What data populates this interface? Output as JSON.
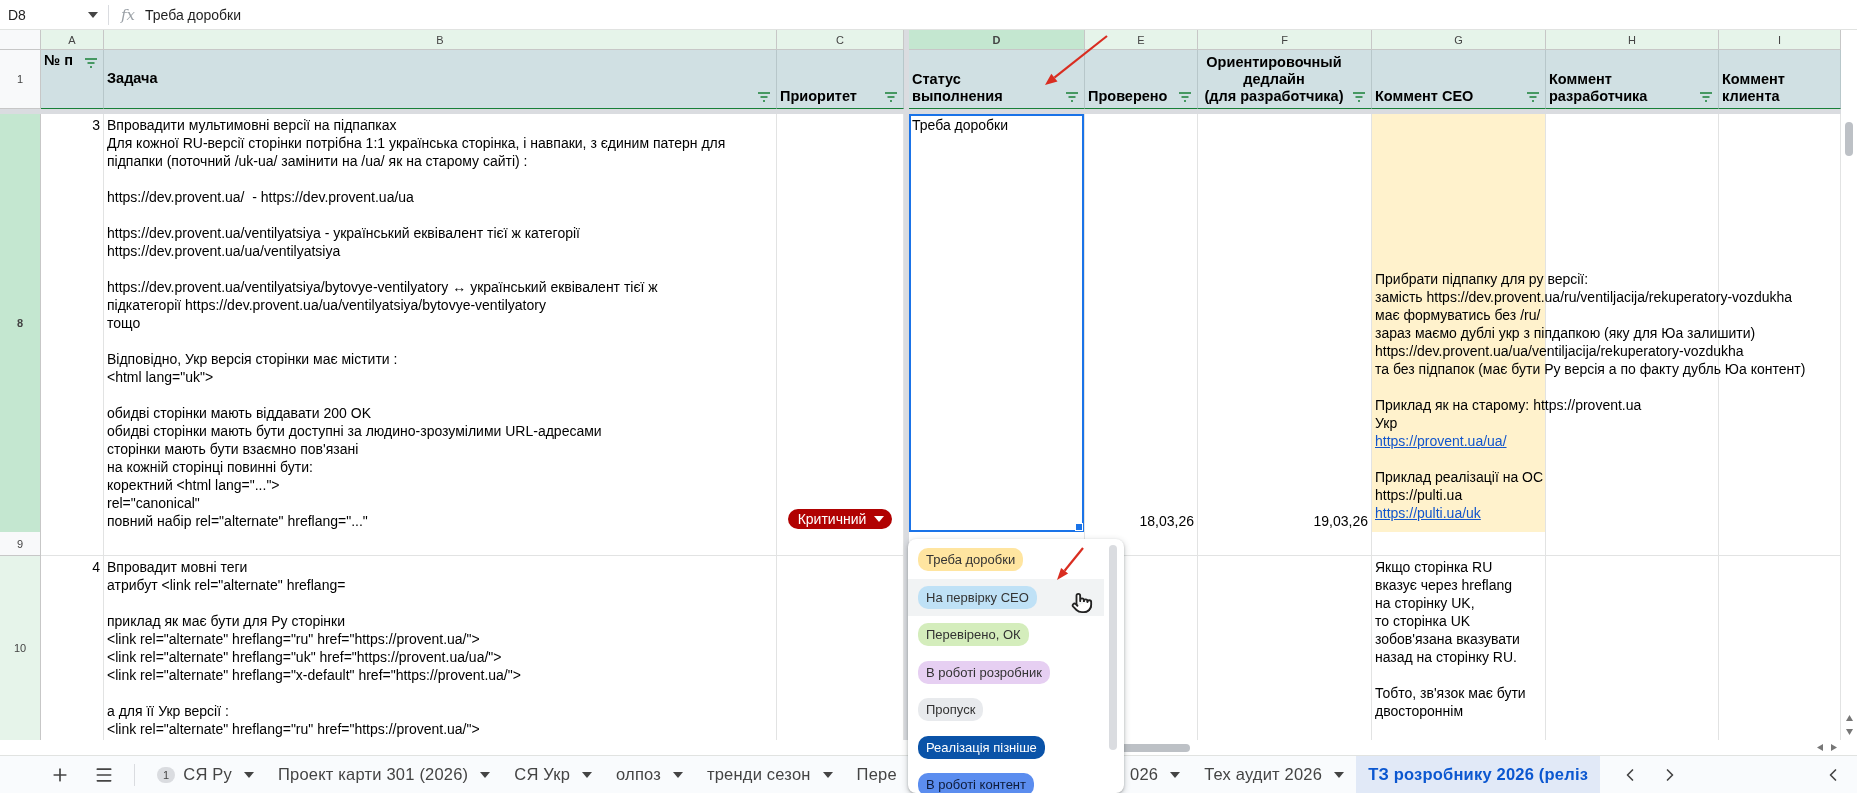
{
  "formula_bar": {
    "cell_ref": "D8",
    "icon_text": "fx",
    "formula": "Треба доробки"
  },
  "columns": [
    {
      "letter": "A",
      "selected": false
    },
    {
      "letter": "B",
      "selected": false
    },
    {
      "letter": "C",
      "selected": false
    },
    {
      "letter": "D",
      "selected": true
    },
    {
      "letter": "E",
      "selected": false
    },
    {
      "letter": "F",
      "selected": false
    },
    {
      "letter": "G",
      "selected": false
    },
    {
      "letter": "H",
      "selected": false
    },
    {
      "letter": "I",
      "selected": false
    }
  ],
  "header_row": {
    "number": "1",
    "cells": [
      {
        "text": "№ п",
        "filter": true
      },
      {
        "text": "Задача",
        "filter": true
      },
      {
        "text": "Приоритет",
        "filter": true
      },
      {
        "text": "Статус\nвыполнения",
        "filter": true
      },
      {
        "text": "Проверено",
        "filter": true
      },
      {
        "text": "Ориентировочный\nдедлайн\n(для разработчика)",
        "filter": true
      },
      {
        "text": "Коммент СЕО",
        "filter": true
      },
      {
        "text": "Коммент\nразработчика",
        "filter": true
      },
      {
        "text": "Коммент\nклиента",
        "filter": false
      }
    ]
  },
  "rows": [
    {
      "number": "8",
      "selected": true,
      "highlighted": false,
      "cells": [
        {
          "kind": "number",
          "text": "3",
          "selected": false
        },
        {
          "kind": "text",
          "selected": false,
          "text": "Впровадити мультимовні версії на підпапках\nДля кожної RU-версії сторінки потрібна 1:1 українська сторінка, і навпаки, з єдиним патерн для\nпідпапки (поточний /uk-ua/ замінити на /ua/ як на старому сайті) :\n\nhttps://dev.provent.ua/  - https://dev.provent.ua/ua\n\nhttps://dev.provent.ua/ventilyatsiya - український еквівалент тієї ж категорії\nhttps://dev.provent.ua/ua/ventilyatsiya\n\nhttps://dev.provent.ua/ventilyatsiya/bytovye-ventilyatory ↔ український еквівалент тієї ж\nпідкатегорії https://dev.provent.ua/ua/ventilyatsiya/bytovye-ventilyatory\nтощо\n\nВідповідно, Укр версія сторінки має містити :\n<html lang=\"uk\">\n\nобидві сторінки мають віддавати 200 OK\nобидві сторінки мають бути доступні за людино-зрозумілими URL-адресами\nсторінки мають бути взаємно пов'язані\nна кожній сторінці повинні бути:\nкоректний <html lang=\"...\">\nrel=\"canonical\"\nповний набір rel=\"alternate\" hreflang=\"...\""
        },
        {
          "kind": "chip",
          "text": "Критичний",
          "selected": false
        },
        {
          "kind": "text",
          "text": "Треба доробки",
          "selected": true
        },
        {
          "kind": "date",
          "text": "18,03,26",
          "selected": false
        },
        {
          "kind": "date",
          "text": "19,03,26",
          "selected": false
        },
        {
          "kind": "note",
          "selected": false,
          "segments": [
            {
              "text": "Прибрати підпапку для ру версії:\nзамість https://dev.provent.ua/ru/ventiljacija/rekuperatory-vozdukha\nмає формуватись без /ru/\nзараз маємо дублі укр з піпдапкою (яку для Юа залишити)\nhttps://dev.provent.ua/ua/ventiljacija/rekuperatory-vozdukha\nта без підпапок (має бути Ру версія а по факту дубль Юа контент)\n\nПриклад як на старому: https://provent.ua\nУкр\n",
              "link": false
            },
            {
              "text": "https://provent.ua/ua/",
              "link": true
            },
            {
              "text": "\n\nПриклад реалізації на ОС\nhttps://pulti.ua\n",
              "link": false
            },
            {
              "text": "https://pulti.ua/uk",
              "link": true
            }
          ]
        }
      ]
    },
    {
      "number": "9",
      "selected": false,
      "highlighted": false,
      "cells": [
        {
          "kind": "empty",
          "selected": false
        },
        {
          "kind": "empty",
          "selected": false
        },
        {
          "kind": "empty",
          "selected": false
        },
        {
          "kind": "covered"
        },
        {
          "kind": "empty",
          "selected": false
        },
        {
          "kind": "empty",
          "selected": false
        },
        {
          "kind": "empty",
          "selected": false
        },
        {
          "kind": "empty",
          "selected": false
        },
        {
          "kind": "empty",
          "selected": false
        }
      ]
    },
    {
      "number": "10",
      "selected": false,
      "highlighted": true,
      "cells": [
        {
          "kind": "number",
          "text": "4",
          "selected": false
        },
        {
          "kind": "text",
          "selected": false,
          "text": "Впровадит мовні теги\nатрибут <link rel=\"alternate\" hreflang=\n\nприклад як має бути для Ру сторінки\n<link rel=\"alternate\" hreflang=\"ru\" href=\"https://provent.ua/\">\n<link rel=\"alternate\" hreflang=\"uk\" href=\"https://provent.ua/ua/\">\n<link rel=\"alternate\" hreflang=\"x-default\" href=\"https://provent.ua/\">\n\nа для її Укр версії :\n<link rel=\"alternate\" hreflang=\"ru\" href=\"https://provent.ua/\">"
        },
        {
          "kind": "empty",
          "selected": false
        },
        {
          "kind": "covered"
        },
        {
          "kind": "empty",
          "selected": false
        },
        {
          "kind": "empty",
          "selected": false
        },
        {
          "kind": "text",
          "selected": false,
          "text": "Якщо сторінка RU\nвказує через hreflang\nна сторінку UK,\nто сторінка UK\nзобов'язана вказувати\nназад на сторінку RU.\n\nТобто, зв'язок має бути\nдвостороннім"
        },
        {
          "kind": "empty",
          "selected": false
        },
        {
          "kind": "empty",
          "selected": false
        }
      ]
    }
  ],
  "status_menu": {
    "options": [
      {
        "label": "Треба доробки",
        "color": "#ffe5a0",
        "hovered": false
      },
      {
        "label": "На первірку СЕО",
        "color": "#bfe1f6",
        "hovered": true
      },
      {
        "label": "Перевірено, ОК",
        "color": "#d4edbc",
        "hovered": false
      },
      {
        "label": "В роботі розробник",
        "color": "#e6cff2",
        "hovered": false
      },
      {
        "label": "Пропуск",
        "color": "#e8eaed",
        "hovered": false
      },
      {
        "label": "Реалізація пізніше",
        "color": "#0a53a8",
        "hovered": false
      },
      {
        "label": "В роботі контент",
        "color": "#5b8def",
        "hovered": false
      }
    ]
  },
  "sheet_tabs": [
    {
      "label": "СЯ Ру",
      "badge": "1",
      "kind": "sheet",
      "selected": false
    },
    {
      "label": "Проект карти 301 (2026)",
      "kind": "sheet",
      "selected": false
    },
    {
      "label": "СЯ Укр",
      "kind": "sheet",
      "selected": false
    },
    {
      "label": "олпоз",
      "kind": "sheet",
      "selected": false
    },
    {
      "label": "тренди сезон",
      "kind": "sheet",
      "selected": false
    },
    {
      "label": "Пере",
      "kind": "cut",
      "selected": false
    },
    {
      "label": "026",
      "kind": "sheet",
      "selected": false
    },
    {
      "label": "Тех аудит 2026",
      "kind": "sheet",
      "selected": false
    },
    {
      "label": "ТЗ розробнику 2026 (реліз",
      "kind": "cut",
      "selected": true
    }
  ]
}
